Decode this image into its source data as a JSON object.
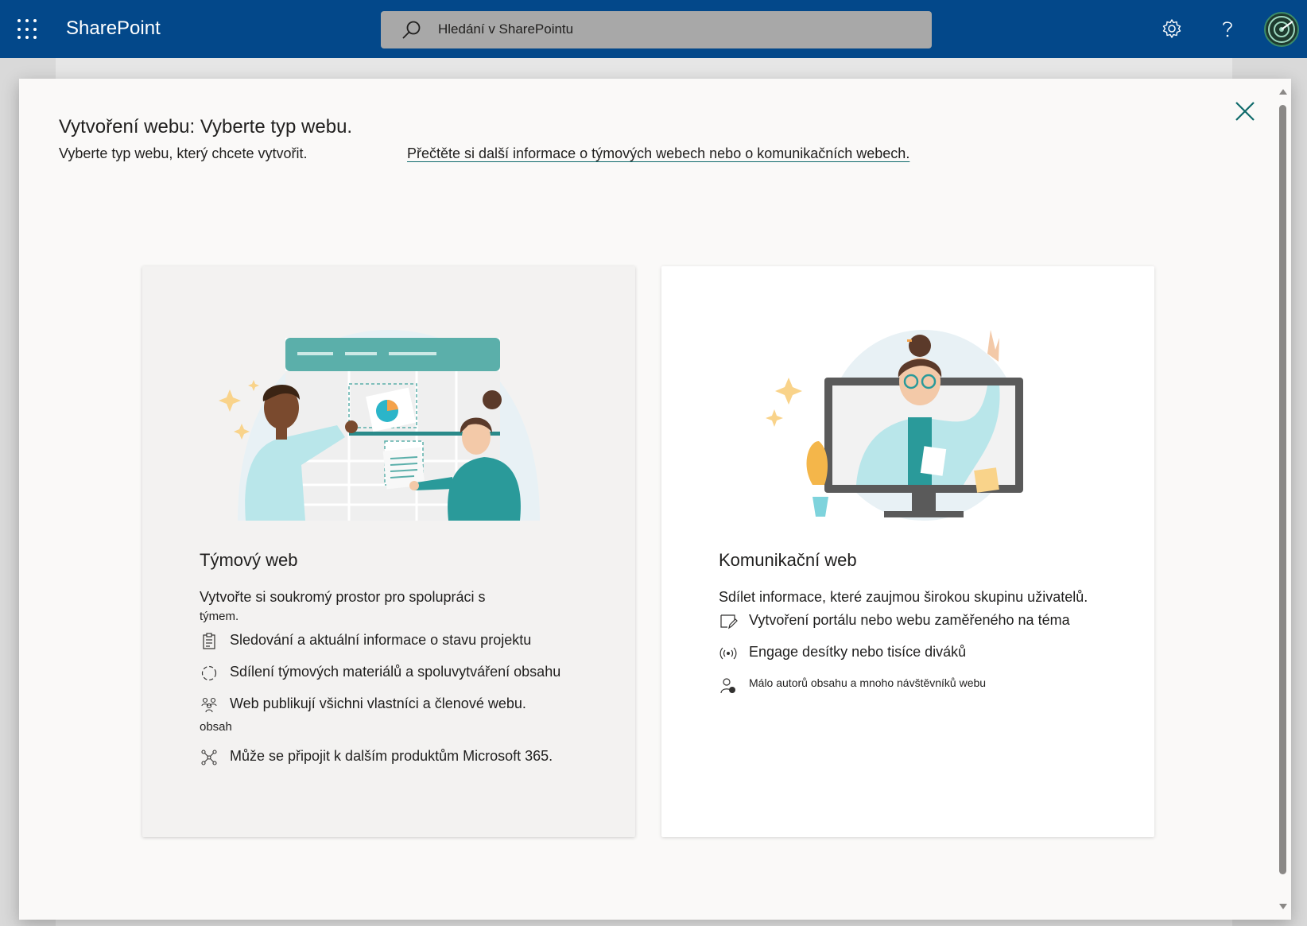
{
  "header": {
    "brand": "SharePoint",
    "search_placeholder": "Hledání v SharePointu",
    "icons": [
      "waffle-icon",
      "search-icon",
      "gear-icon",
      "help-icon",
      "avatar"
    ]
  },
  "dialog": {
    "title": "Vytvoření webu: Vyberte typ webu.",
    "subtitle": "Vyberte typ webu, který chcete vytvořit.",
    "learn_link": "Přečtěte si další informace o týmových webech nebo o komunikačních webech."
  },
  "team_card": {
    "title": "Týmový web",
    "description": "Vytvořte si soukromý prostor pro spolupráci s",
    "description_cont": "týmem.",
    "features": [
      {
        "icon": "clipboard-checklist-icon",
        "text": "Sledování a aktuální informace o stavu projektu"
      },
      {
        "icon": "sync-circle-icon",
        "text": "Sdílení týmových materiálů a spoluvytváření obsahu"
      },
      {
        "icon": "people-group-icon",
        "text": "Web publikují všichni vlastníci a členové webu."
      },
      {
        "icon": "network-nodes-icon",
        "text": "Může se připojit k dalším produktům Microsoft 365."
      }
    ],
    "feature_3_sub": "obsah"
  },
  "comm_card": {
    "title": "Komunikační web",
    "description": "Sdílet informace, které zaujmou širokou skupinu uživatelů.",
    "features": [
      {
        "icon": "edit-page-icon",
        "text": "Vytvoření portálu nebo webu zaměřeného na téma"
      },
      {
        "icon": "broadcast-icon",
        "text": "Engage desítky nebo tisíce diváků"
      },
      {
        "icon": "person-authors-icon",
        "text": "Málo autorů obsahu a mnoho návštěvníků webu"
      }
    ]
  },
  "colors": {
    "suitebar": "#03488a",
    "accent_teal": "#0f6a6b",
    "dialog_bg": "#faf9f8"
  }
}
